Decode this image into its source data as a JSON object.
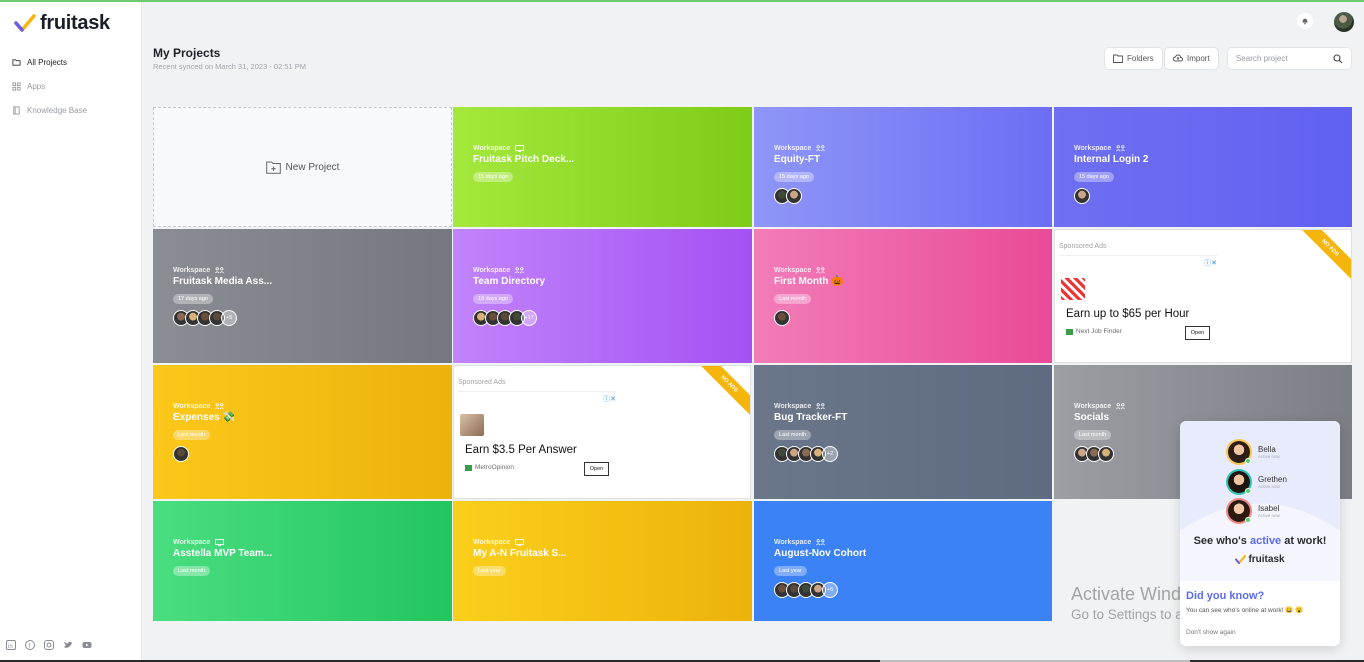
{
  "brand": {
    "name": "fruitask"
  },
  "sidebar": {
    "items": [
      {
        "label": "All Projects",
        "icon": "folder-icon",
        "active": true
      },
      {
        "label": "Apps",
        "icon": "apps-grid-icon",
        "active": false
      },
      {
        "label": "Knowledge Base",
        "icon": "book-icon",
        "active": false
      }
    ],
    "socials": [
      "linkedin-icon",
      "facebook-icon",
      "instagram-icon",
      "twitter-icon",
      "youtube-icon"
    ]
  },
  "header": {
    "title": "My Projects",
    "synced": "Recent synced on March 31, 2023 - 02:51 PM",
    "folders_label": "Folders",
    "import_label": "Import",
    "search_placeholder": "Search project"
  },
  "new_project_label": "New Project",
  "projects": [
    {
      "workspace": "Workspace",
      "title": "Fruitask Pitch Deck...",
      "time": "15 days ago",
      "avatar_count": 0,
      "more": "",
      "color_from": "#a5e83d",
      "color_to": "#7dcc17",
      "icon": "monitor-icon"
    },
    {
      "workspace": "Workspace",
      "title": "Equity-FT",
      "time": "15 days ago",
      "avatar_count": 2,
      "more": "",
      "color_from": "#8f96f7",
      "color_to": "#6c6ef4",
      "icon": "team-icon"
    },
    {
      "workspace": "Workspace",
      "title": "Internal Login 2",
      "time": "15 days ago",
      "avatar_count": 1,
      "more": "",
      "color_from": "#6f6ff2",
      "color_to": "#6161f1",
      "icon": "team-icon"
    },
    {
      "workspace": "Workspace",
      "title": "Fruitask Media Ass...",
      "time": "17 days ago",
      "avatar_count": 4,
      "more": "+5",
      "color_from": "#8b8d94",
      "color_to": "#75777f",
      "icon": "team-icon"
    },
    {
      "workspace": "Workspace",
      "title": "Team Directory",
      "time": "18 days ago",
      "avatar_count": 4,
      "more": "+17",
      "color_from": "#c184fb",
      "color_to": "#a451f2",
      "icon": "team-icon"
    },
    {
      "workspace": "Workspace",
      "title": "First Month 🎃",
      "time": "Last month",
      "avatar_count": 1,
      "more": "",
      "color_from": "#f27cb8",
      "color_to": "#e94b97",
      "icon": "team-icon"
    },
    {
      "workspace": "Workspace",
      "title": "Expenses 💸",
      "time": "Last month",
      "avatar_count": 1,
      "more": "",
      "color_from": "#fbc81a",
      "color_to": "#ecb30a",
      "icon": "team-icon"
    },
    {
      "workspace": "Workspace",
      "title": "Bug Tracker-FT",
      "time": "Last month",
      "avatar_count": 4,
      "more": "+2",
      "color_from": "#6a7689",
      "color_to": "#5e6b80",
      "icon": "team-icon"
    },
    {
      "workspace": "Workspace",
      "title": "Socials",
      "time": "Last month",
      "avatar_count": 3,
      "more": "",
      "color_from": "#9c9ea4",
      "color_to": "#7c7e85",
      "icon": "team-icon"
    },
    {
      "workspace": "Workspace",
      "title": "Asstella MVP Team...",
      "time": "Last month",
      "avatar_count": 0,
      "more": "",
      "color_from": "#4ade80",
      "color_to": "#22c55e",
      "icon": "monitor-icon"
    },
    {
      "workspace": "Workspace",
      "title": "My A-N Fruitask S...",
      "time": "Last year",
      "avatar_count": 0,
      "more": "",
      "color_from": "#fbcf1c",
      "color_to": "#ecb30a",
      "icon": "monitor-icon"
    },
    {
      "workspace": "Workspace",
      "title": "August-Nov Cohort",
      "time": "Last year",
      "avatar_count": 4,
      "more": "+6",
      "color_from": "#3b82f6",
      "color_to": "#3b82f6",
      "icon": "team-icon"
    }
  ],
  "ads": [
    {
      "sponsored": "Sponsored Ads",
      "headline": "Earn up to $65 per Hour",
      "source": "Next Job Finder",
      "open": "Open",
      "ribbon": "NO ADS"
    },
    {
      "sponsored": "Sponsored Ads",
      "headline": "Earn $3.5 Per Answer",
      "source": "MetroOpinion",
      "open": "Open",
      "ribbon": "NO ADS"
    }
  ],
  "widget": {
    "people": [
      {
        "name": "Bella",
        "status": "Active now"
      },
      {
        "name": "Grethen",
        "status": "Active now"
      },
      {
        "name": "Isabel",
        "status": "Active now"
      }
    ],
    "headline_pre": "See who's",
    "headline_hl": "active",
    "headline_post": "at work!",
    "brand": "fruitask",
    "dyk_title": "Did you know?",
    "dyk_text": "You can see who's online at work! 😀 😮",
    "dont_show": "Don't show again"
  },
  "watermark": {
    "line1": "Activate Windows",
    "line2": "Go to Settings to activate Windows."
  },
  "colors": {
    "accent": "#5b6bf0",
    "online": "#4ad26b",
    "ribbon": "#f5b50a"
  }
}
